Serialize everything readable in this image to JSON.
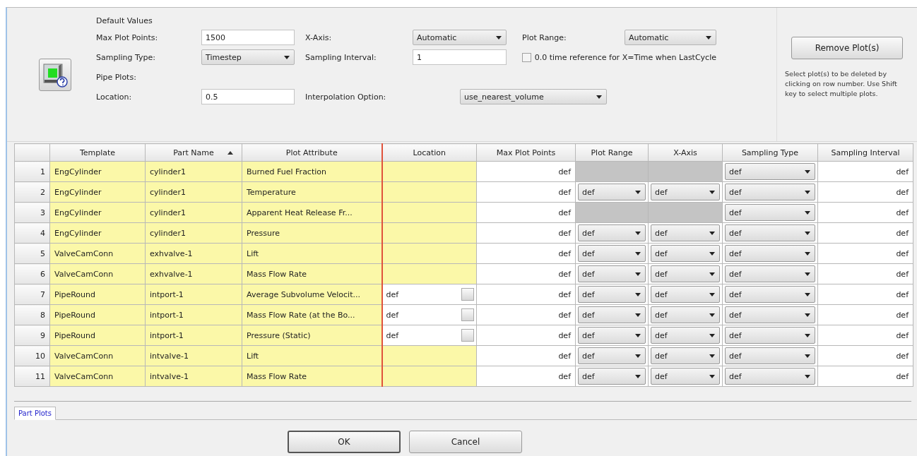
{
  "defaults": {
    "title": "Default Values",
    "max_plot_points": {
      "label": "Max Plot Points:",
      "value": "1500"
    },
    "x_axis": {
      "label": "X-Axis:",
      "value": "Automatic"
    },
    "plot_range": {
      "label": "Plot Range:",
      "value": "Automatic"
    },
    "sampling_type": {
      "label": "Sampling Type:",
      "value": "Timestep"
    },
    "sampling_interval": {
      "label": "Sampling Interval:",
      "value": "1"
    },
    "time_reference": {
      "label": "0.0 time reference for X=Time when LastCycle",
      "checked": false
    },
    "pipe_plots": "Pipe Plots:",
    "location": {
      "label": "Location:",
      "value": "0.5"
    },
    "interpolation": {
      "label": "Interpolation Option:",
      "value": "use_nearest_volume"
    }
  },
  "remove_button": "Remove Plot(s)",
  "help_text": "Select plot(s) to be deleted by clicking on row number. Use Shift key to select multiple plots.",
  "table": {
    "columns": [
      {
        "label": "Template",
        "sorted": false
      },
      {
        "label": "Part Name",
        "sorted": true
      },
      {
        "label": "Plot Attribute",
        "sorted": false
      },
      {
        "label": "Location",
        "sorted": false
      },
      {
        "label": "Max Plot Points",
        "sorted": false
      },
      {
        "label": "Plot Range",
        "sorted": false
      },
      {
        "label": "X-Axis",
        "sorted": false
      },
      {
        "label": "Sampling Type",
        "sorted": false
      },
      {
        "label": "Sampling Interval",
        "sorted": false
      }
    ],
    "rows": [
      {
        "number": "1",
        "template": "EngCylinder",
        "part_name": "cylinder1",
        "plot_attribute": "Burned Fuel Fraction",
        "max_plot_points": "def",
        "axis_disabled": true,
        "sampling_type": "def",
        "sampling_interval": "def"
      },
      {
        "number": "2",
        "template": "EngCylinder",
        "part_name": "cylinder1",
        "plot_attribute": "Temperature",
        "max_plot_points": "def",
        "axis_disabled": false,
        "plot_range": "def",
        "x_axis": "def",
        "sampling_type": "def",
        "sampling_interval": "def"
      },
      {
        "number": "3",
        "template": "EngCylinder",
        "part_name": "cylinder1",
        "plot_attribute": "Apparent Heat Release Fr...",
        "max_plot_points": "def",
        "axis_disabled": true,
        "sampling_type": "def",
        "sampling_interval": "def"
      },
      {
        "number": "4",
        "template": "EngCylinder",
        "part_name": "cylinder1",
        "plot_attribute": "Pressure",
        "max_plot_points": "def",
        "axis_disabled": false,
        "plot_range": "def",
        "x_axis": "def",
        "sampling_type": "def",
        "sampling_interval": "def"
      },
      {
        "number": "5",
        "template": "ValveCamConn",
        "part_name": "exhvalve-1",
        "plot_attribute": "Lift",
        "max_plot_points": "def",
        "axis_disabled": false,
        "plot_range": "def",
        "x_axis": "def",
        "sampling_type": "def",
        "sampling_interval": "def"
      },
      {
        "number": "6",
        "template": "ValveCamConn",
        "part_name": "exhvalve-1",
        "plot_attribute": "Mass Flow Rate",
        "max_plot_points": "def",
        "axis_disabled": false,
        "plot_range": "def",
        "x_axis": "def",
        "sampling_type": "def",
        "sampling_interval": "def"
      },
      {
        "number": "7",
        "template": "PipeRound",
        "part_name": "intport-1",
        "plot_attribute": "Average Subvolume Velocit...",
        "location": "def",
        "max_plot_points": "def",
        "axis_disabled": false,
        "plot_range": "def",
        "x_axis": "def",
        "sampling_type": "def",
        "sampling_interval": "def"
      },
      {
        "number": "8",
        "template": "PipeRound",
        "part_name": "intport-1",
        "plot_attribute": "Mass Flow Rate (at the Bo...",
        "location": "def",
        "max_plot_points": "def",
        "axis_disabled": false,
        "plot_range": "def",
        "x_axis": "def",
        "sampling_type": "def",
        "sampling_interval": "def"
      },
      {
        "number": "9",
        "template": "PipeRound",
        "part_name": "intport-1",
        "plot_attribute": "Pressure (Static)",
        "location": "def",
        "max_plot_points": "def",
        "axis_disabled": false,
        "plot_range": "def",
        "x_axis": "def",
        "sampling_type": "def",
        "sampling_interval": "def"
      },
      {
        "number": "10",
        "template": "ValveCamConn",
        "part_name": "intvalve-1",
        "plot_attribute": "Lift",
        "max_plot_points": "def",
        "axis_disabled": false,
        "plot_range": "def",
        "x_axis": "def",
        "sampling_type": "def",
        "sampling_interval": "def"
      },
      {
        "number": "11",
        "template": "ValveCamConn",
        "part_name": "intvalve-1",
        "plot_attribute": "Mass Flow Rate",
        "max_plot_points": "def",
        "axis_disabled": false,
        "plot_range": "def",
        "x_axis": "def",
        "sampling_type": "def",
        "sampling_interval": "def"
      }
    ]
  },
  "tabs": [
    {
      "label": "Part Plots",
      "selected": true
    }
  ],
  "buttons": [
    {
      "label": "OK",
      "default": true
    },
    {
      "label": "Cancel",
      "default": false
    }
  ]
}
